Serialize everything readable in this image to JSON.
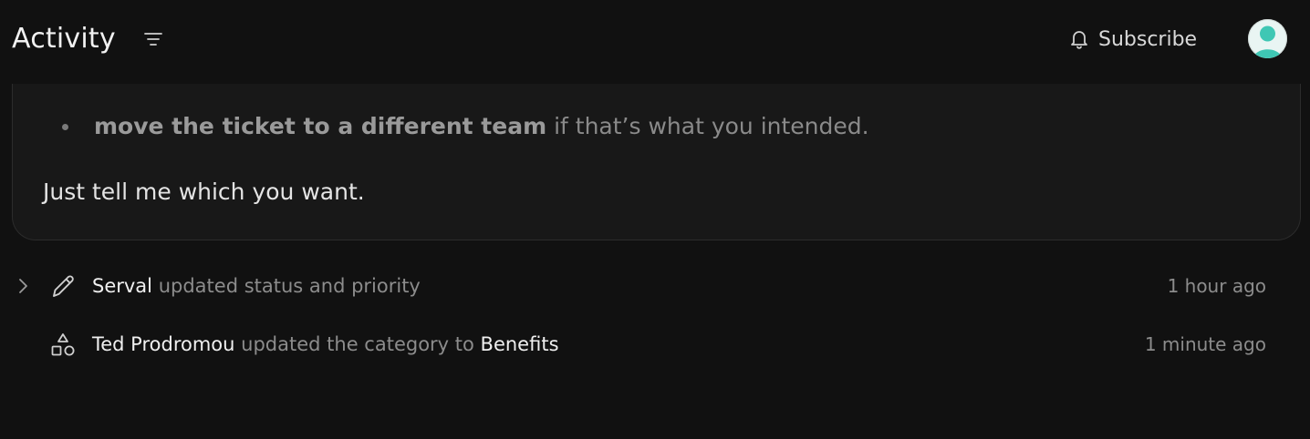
{
  "header": {
    "title": "Activity",
    "subscribe_label": "Subscribe"
  },
  "icons": {
    "filter": "filter-lines-icon",
    "bell": "bell-icon",
    "avatar": "user-avatar-icon",
    "chevron": "chevron-right-icon",
    "pencil": "pencil-icon",
    "shapes": "shapes-icon"
  },
  "comment": {
    "bullet_bold": "move the ticket to a different team",
    "bullet_rest": " if that’s what you intended.",
    "closing": "Just tell me which you want."
  },
  "activity": [
    {
      "actor": "Serval",
      "action": "updated status and priority",
      "value": "",
      "time": "1 hour ago"
    },
    {
      "actor": "Ted Prodromou",
      "action": "updated the category to",
      "value": "Benefits",
      "time": "1 minute ago"
    }
  ],
  "colors": {
    "background": "#111111",
    "card": "#181818",
    "avatar_accent": "#3fc7b4"
  }
}
